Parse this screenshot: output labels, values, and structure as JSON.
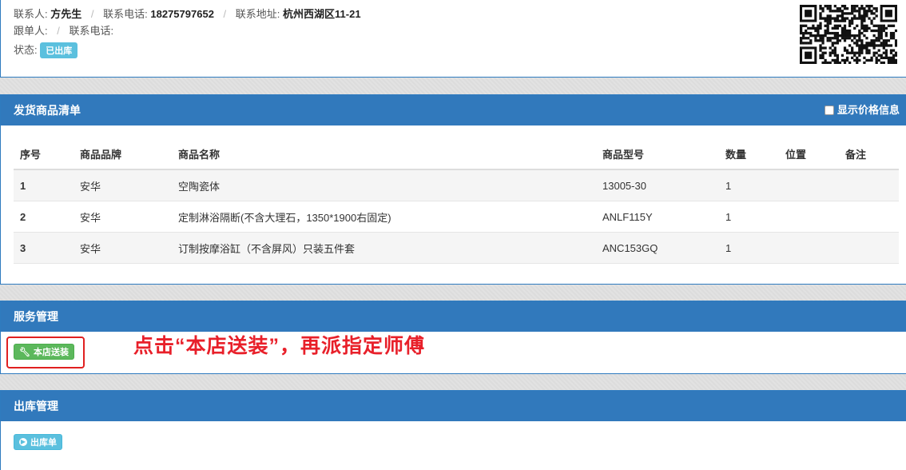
{
  "info": {
    "contact_label": "联系人:",
    "contact_name": "方先生",
    "phone_label": "联系电话:",
    "phone": "18275797652",
    "address_label": "联系地址:",
    "address": "杭州西湖区11-21",
    "follow_label": "跟单人:",
    "follow_phone_label": "联系电话:",
    "status_label": "状态:",
    "status_badge": "已出库",
    "separator": "/"
  },
  "goods": {
    "title": "发货商品清单",
    "show_price_label": "显示价格信息",
    "headers": [
      "序号",
      "商品品牌",
      "商品名称",
      "商品型号",
      "数量",
      "位置",
      "备注"
    ],
    "rows": [
      {
        "idx": "1",
        "brand": "安华",
        "name": "空陶瓷体",
        "model": "13005-30",
        "qty": "1",
        "pos": "",
        "note": ""
      },
      {
        "idx": "2",
        "brand": "安华",
        "name": "定制淋浴隔断(不含大理石，1350*1900右固定)",
        "model": "ANLF115Y",
        "qty": "1",
        "pos": "",
        "note": ""
      },
      {
        "idx": "3",
        "brand": "安华",
        "name": "订制按摩浴缸（不含屏风）只装五件套",
        "model": "ANC153GQ",
        "qty": "1",
        "pos": "",
        "note": ""
      }
    ]
  },
  "service": {
    "title": "服务管理",
    "button_label": "本店送装",
    "annotation": "点击“本店送装”，再派指定师傅"
  },
  "outbound": {
    "title": "出库管理",
    "button_label": "出库单"
  },
  "icons": {
    "wrench": "wrench-icon",
    "arrow": "arrow-circle-icon",
    "qr": "qr-code-icon"
  },
  "colors": {
    "panel_header": "#3179bc",
    "badge": "#5bc0de",
    "success_button": "#5cb85c",
    "info_button": "#5bc0de",
    "annotation": "#e8202a"
  }
}
